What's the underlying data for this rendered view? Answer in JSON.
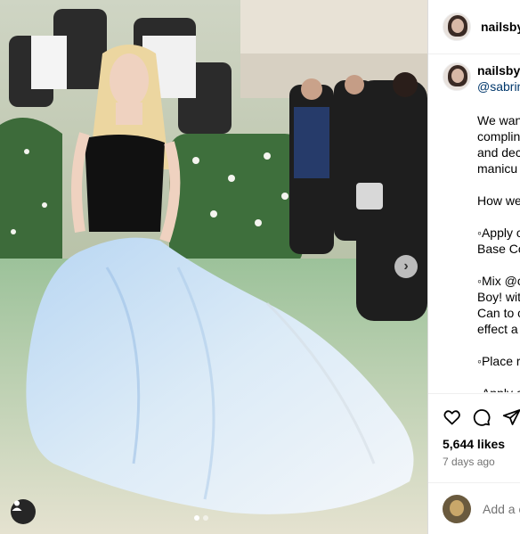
{
  "post": {
    "username": "nailsby",
    "caption_username": "nailsby",
    "caption_mention": "@sabrin",
    "caption_lines": [
      "We wan",
      "complin",
      "and dec",
      "manicu",
      "",
      "How we",
      "",
      "◦Apply c",
      "Base Co",
      "",
      "◦Mix @c",
      "Boy! wit",
      "Can to c",
      "effect a",
      "",
      "◦Place r",
      "",
      "◦Apply c"
    ],
    "likes": "5,644 likes",
    "time_ago": "7 days ago",
    "comment_placeholder": "Add a c"
  },
  "media": {
    "carousel_total": 2,
    "carousel_active": 0
  },
  "icons": {
    "like": "heart-icon",
    "comment": "comment-icon",
    "share": "share-icon",
    "next": "chevron-right-icon",
    "tags": "user-tag-icon"
  },
  "colors": {
    "mention": "#00376b",
    "secondary_text": "#737373",
    "border": "#dbdbdb"
  }
}
